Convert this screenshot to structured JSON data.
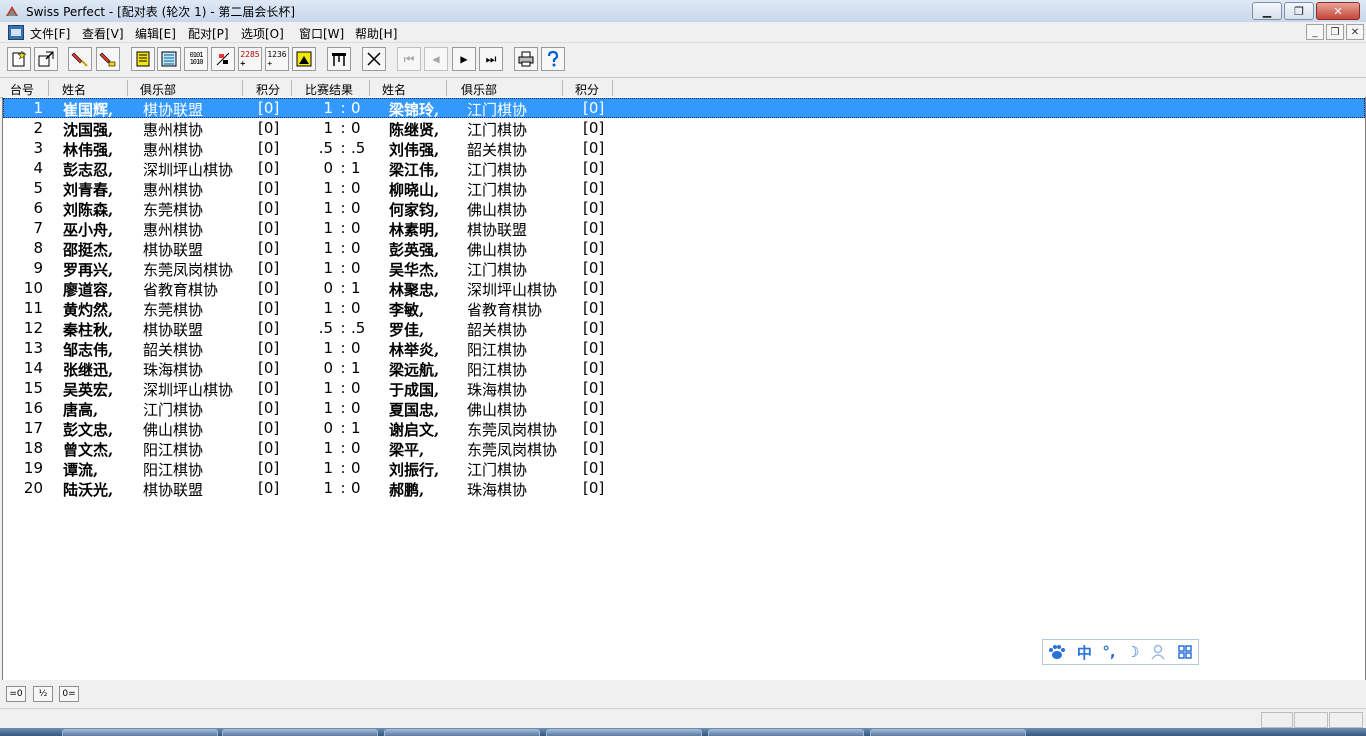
{
  "window": {
    "title": "Swiss Perfect - [配对表 (轮次 1) - 第二届会长杯]"
  },
  "menu": [
    "文件[F]",
    "查看[V]",
    "编辑[E]",
    "配对[P]",
    "选项[O]",
    "窗口[W]",
    "帮助[H]"
  ],
  "columns": [
    "台号",
    "姓名",
    "俱乐部",
    "积分",
    "比赛结果",
    "姓名",
    "俱乐部",
    "积分"
  ],
  "rows": [
    {
      "board": "1",
      "name1": "崔国辉,",
      "club1": "棋协联盟",
      "pts1": "[0]",
      "res1": "1",
      "sep": ":",
      "res2": "0",
      "name2": "梁锦玲,",
      "club2": "江门棋协",
      "pts2": "[0]"
    },
    {
      "board": "2",
      "name1": "沈国强,",
      "club1": "惠州棋协",
      "pts1": "[0]",
      "res1": "1",
      "sep": ":",
      "res2": "0",
      "name2": "陈继贤,",
      "club2": "江门棋协",
      "pts2": "[0]"
    },
    {
      "board": "3",
      "name1": "林伟强,",
      "club1": "惠州棋协",
      "pts1": "[0]",
      "res1": ".5",
      "sep": ":",
      "res2": ".5",
      "name2": "刘伟强,",
      "club2": "韶关棋协",
      "pts2": "[0]"
    },
    {
      "board": "4",
      "name1": "彭志忍,",
      "club1": "深圳坪山棋协",
      "pts1": "[0]",
      "res1": "0",
      "sep": ":",
      "res2": "1",
      "name2": "梁江伟,",
      "club2": "江门棋协",
      "pts2": "[0]"
    },
    {
      "board": "5",
      "name1": "刘青春,",
      "club1": "惠州棋协",
      "pts1": "[0]",
      "res1": "1",
      "sep": ":",
      "res2": "0",
      "name2": "柳晓山,",
      "club2": "江门棋协",
      "pts2": "[0]"
    },
    {
      "board": "6",
      "name1": "刘陈森,",
      "club1": "东莞棋协",
      "pts1": "[0]",
      "res1": "1",
      "sep": ":",
      "res2": "0",
      "name2": "何家钧,",
      "club2": "佛山棋协",
      "pts2": "[0]"
    },
    {
      "board": "7",
      "name1": "巫小舟,",
      "club1": "惠州棋协",
      "pts1": "[0]",
      "res1": "1",
      "sep": ":",
      "res2": "0",
      "name2": "林素明,",
      "club2": "棋协联盟",
      "pts2": "[0]"
    },
    {
      "board": "8",
      "name1": "邵挺杰,",
      "club1": "棋协联盟",
      "pts1": "[0]",
      "res1": "1",
      "sep": ":",
      "res2": "0",
      "name2": "彭英强,",
      "club2": "佛山棋协",
      "pts2": "[0]"
    },
    {
      "board": "9",
      "name1": "罗再兴,",
      "club1": "东莞凤岗棋协",
      "pts1": "[0]",
      "res1": "1",
      "sep": ":",
      "res2": "0",
      "name2": "吴华杰,",
      "club2": "江门棋协",
      "pts2": "[0]"
    },
    {
      "board": "10",
      "name1": "廖道容,",
      "club1": "省教育棋协",
      "pts1": "[0]",
      "res1": "0",
      "sep": ":",
      "res2": "1",
      "name2": "林聚忠,",
      "club2": "深圳坪山棋协",
      "pts2": "[0]"
    },
    {
      "board": "11",
      "name1": "黄灼然,",
      "club1": "东莞棋协",
      "pts1": "[0]",
      "res1": "1",
      "sep": ":",
      "res2": "0",
      "name2": "李敏,",
      "club2": "省教育棋协",
      "pts2": "[0]"
    },
    {
      "board": "12",
      "name1": "秦柱秋,",
      "club1": "棋协联盟",
      "pts1": "[0]",
      "res1": ".5",
      "sep": ":",
      "res2": ".5",
      "name2": "罗佳,",
      "club2": "韶关棋协",
      "pts2": "[0]"
    },
    {
      "board": "13",
      "name1": "邹志伟,",
      "club1": "韶关棋协",
      "pts1": "[0]",
      "res1": "1",
      "sep": ":",
      "res2": "0",
      "name2": "林举炎,",
      "club2": "阳江棋协",
      "pts2": "[0]"
    },
    {
      "board": "14",
      "name1": "张继迅,",
      "club1": "珠海棋协",
      "pts1": "[0]",
      "res1": "0",
      "sep": ":",
      "res2": "1",
      "name2": "梁远航,",
      "club2": "阳江棋协",
      "pts2": "[0]"
    },
    {
      "board": "15",
      "name1": "吴英宏,",
      "club1": "深圳坪山棋协",
      "pts1": "[0]",
      "res1": "1",
      "sep": ":",
      "res2": "0",
      "name2": "于成国,",
      "club2": "珠海棋协",
      "pts2": "[0]"
    },
    {
      "board": "16",
      "name1": "唐高,",
      "club1": "江门棋协",
      "pts1": "[0]",
      "res1": "1",
      "sep": ":",
      "res2": "0",
      "name2": "夏国忠,",
      "club2": "佛山棋协",
      "pts2": "[0]"
    },
    {
      "board": "17",
      "name1": "彭文忠,",
      "club1": "佛山棋协",
      "pts1": "[0]",
      "res1": "0",
      "sep": ":",
      "res2": "1",
      "name2": "谢启文,",
      "club2": "东莞凤岗棋协",
      "pts2": "[0]"
    },
    {
      "board": "18",
      "name1": "曾文杰,",
      "club1": "阳江棋协",
      "pts1": "[0]",
      "res1": "1",
      "sep": ":",
      "res2": "0",
      "name2": "梁平,",
      "club2": "东莞凤岗棋协",
      "pts2": "[0]"
    },
    {
      "board": "19",
      "name1": "谭流,",
      "club1": "阳江棋协",
      "pts1": "[0]",
      "res1": "1",
      "sep": ":",
      "res2": "0",
      "name2": "刘振行,",
      "club2": "江门棋协",
      "pts2": "[0]"
    },
    {
      "board": "20",
      "name1": "陆沃光,",
      "club1": "棋协联盟",
      "pts1": "[0]",
      "res1": "1",
      "sep": ":",
      "res2": "0",
      "name2": "郝鹏,",
      "club2": "珠海棋协",
      "pts2": "[0]"
    }
  ],
  "selected_row": 0,
  "ime": {
    "items": [
      "中",
      "°,",
      "☽"
    ]
  },
  "bottom_buttons": [
    "=0",
    "½",
    "0="
  ]
}
